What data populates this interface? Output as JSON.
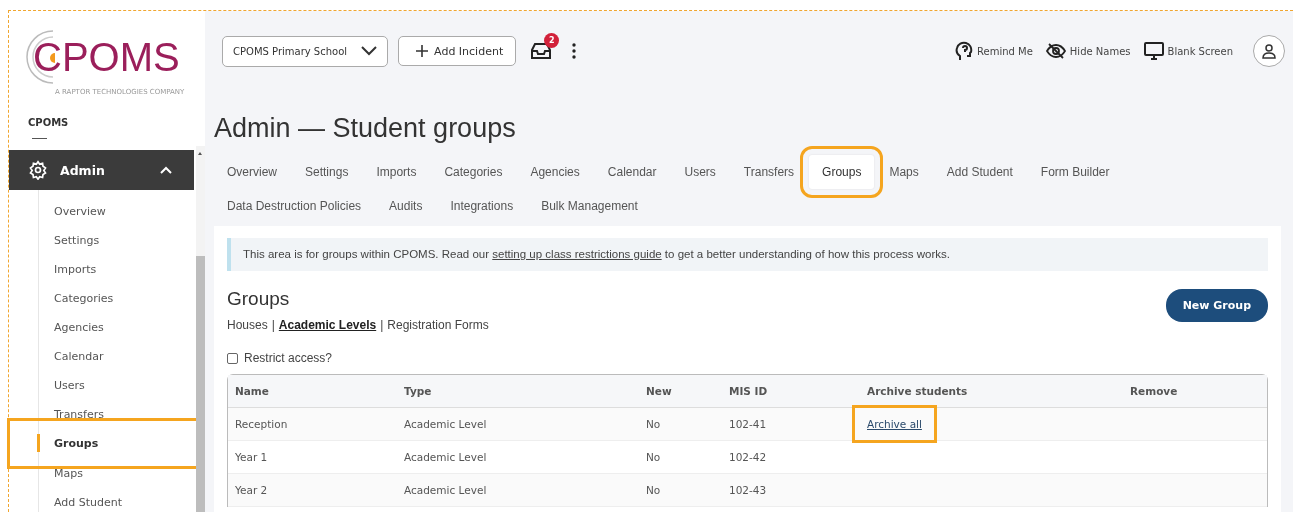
{
  "sidebar": {
    "logo": {
      "name": "CPOMS",
      "tagline": "A RAPTOR TECHNOLOGIES COMPANY"
    },
    "section_label": "CPOMS",
    "menu": {
      "label": "Admin",
      "expanded": true,
      "items": [
        {
          "label": "Overview",
          "selected": false,
          "highlighted": false
        },
        {
          "label": "Settings",
          "selected": false,
          "highlighted": false
        },
        {
          "label": "Imports",
          "selected": false,
          "highlighted": false
        },
        {
          "label": "Categories",
          "selected": false,
          "highlighted": false
        },
        {
          "label": "Agencies",
          "selected": false,
          "highlighted": false
        },
        {
          "label": "Calendar",
          "selected": false,
          "highlighted": false
        },
        {
          "label": "Users",
          "selected": false,
          "highlighted": false
        },
        {
          "label": "Transfers",
          "selected": false,
          "highlighted": false
        },
        {
          "label": "Groups",
          "selected": true,
          "highlighted": true
        },
        {
          "label": "Maps",
          "selected": false,
          "highlighted": false
        },
        {
          "label": "Add Student",
          "selected": false,
          "highlighted": false
        }
      ]
    }
  },
  "topbar": {
    "school_select": {
      "value": "CPOMS Primary School"
    },
    "add_button": "Add Incident",
    "inbox_badge": "2",
    "tools": [
      {
        "kind": "remind",
        "label": "Remind Me"
      },
      {
        "kind": "hide",
        "label": "Hide Names"
      },
      {
        "kind": "blank",
        "label": "Blank Screen"
      }
    ]
  },
  "page_title": "Admin — Student groups",
  "tabs": [
    {
      "label": "Overview",
      "selected": false,
      "highlighted": false
    },
    {
      "label": "Settings",
      "selected": false,
      "highlighted": false
    },
    {
      "label": "Imports",
      "selected": false,
      "highlighted": false
    },
    {
      "label": "Categories",
      "selected": false,
      "highlighted": false
    },
    {
      "label": "Agencies",
      "selected": false,
      "highlighted": false
    },
    {
      "label": "Calendar",
      "selected": false,
      "highlighted": false
    },
    {
      "label": "Users",
      "selected": false,
      "highlighted": false
    },
    {
      "label": "Transfers",
      "selected": false,
      "highlighted": false
    },
    {
      "label": "Groups",
      "selected": true,
      "highlighted": true
    },
    {
      "label": "Maps",
      "selected": false,
      "highlighted": false
    },
    {
      "label": "Add Student",
      "selected": false,
      "highlighted": false
    },
    {
      "label": "Form Builder",
      "selected": false,
      "highlighted": false
    },
    {
      "label": "Data Destruction Policies",
      "selected": false,
      "highlighted": false
    },
    {
      "label": "Audits",
      "selected": false,
      "highlighted": false
    },
    {
      "label": "Integrations",
      "selected": false,
      "highlighted": false
    },
    {
      "label": "Bulk Management",
      "selected": false,
      "highlighted": false
    }
  ],
  "info": {
    "text_before": "This area is for groups within CPOMS. Read our",
    "link": "setting up class restrictions guide",
    "text_after": "to get a better understanding of how this process works."
  },
  "groups": {
    "heading": "Groups",
    "new_button": "New Group",
    "filters": [
      {
        "label": "Houses",
        "selected": false
      },
      {
        "label": "Academic Levels",
        "selected": true
      },
      {
        "label": "Registration Forms",
        "selected": false
      }
    ],
    "filter_separator": "|",
    "restrict": {
      "label": "Restrict access?",
      "checked": false
    },
    "columns": [
      "Name",
      "Type",
      "New",
      "MIS ID",
      "Archive students",
      "Remove"
    ],
    "rows": [
      {
        "name": "Reception",
        "type": "Academic Level",
        "new": "No",
        "mis_id": "102-41",
        "archive": {
          "label": "Archive all",
          "highlighted": true
        }
      },
      {
        "name": "Year 1",
        "type": "Academic Level",
        "new": "No",
        "mis_id": "102-42"
      },
      {
        "name": "Year 2",
        "type": "Academic Level",
        "new": "No",
        "mis_id": "102-43"
      }
    ]
  }
}
